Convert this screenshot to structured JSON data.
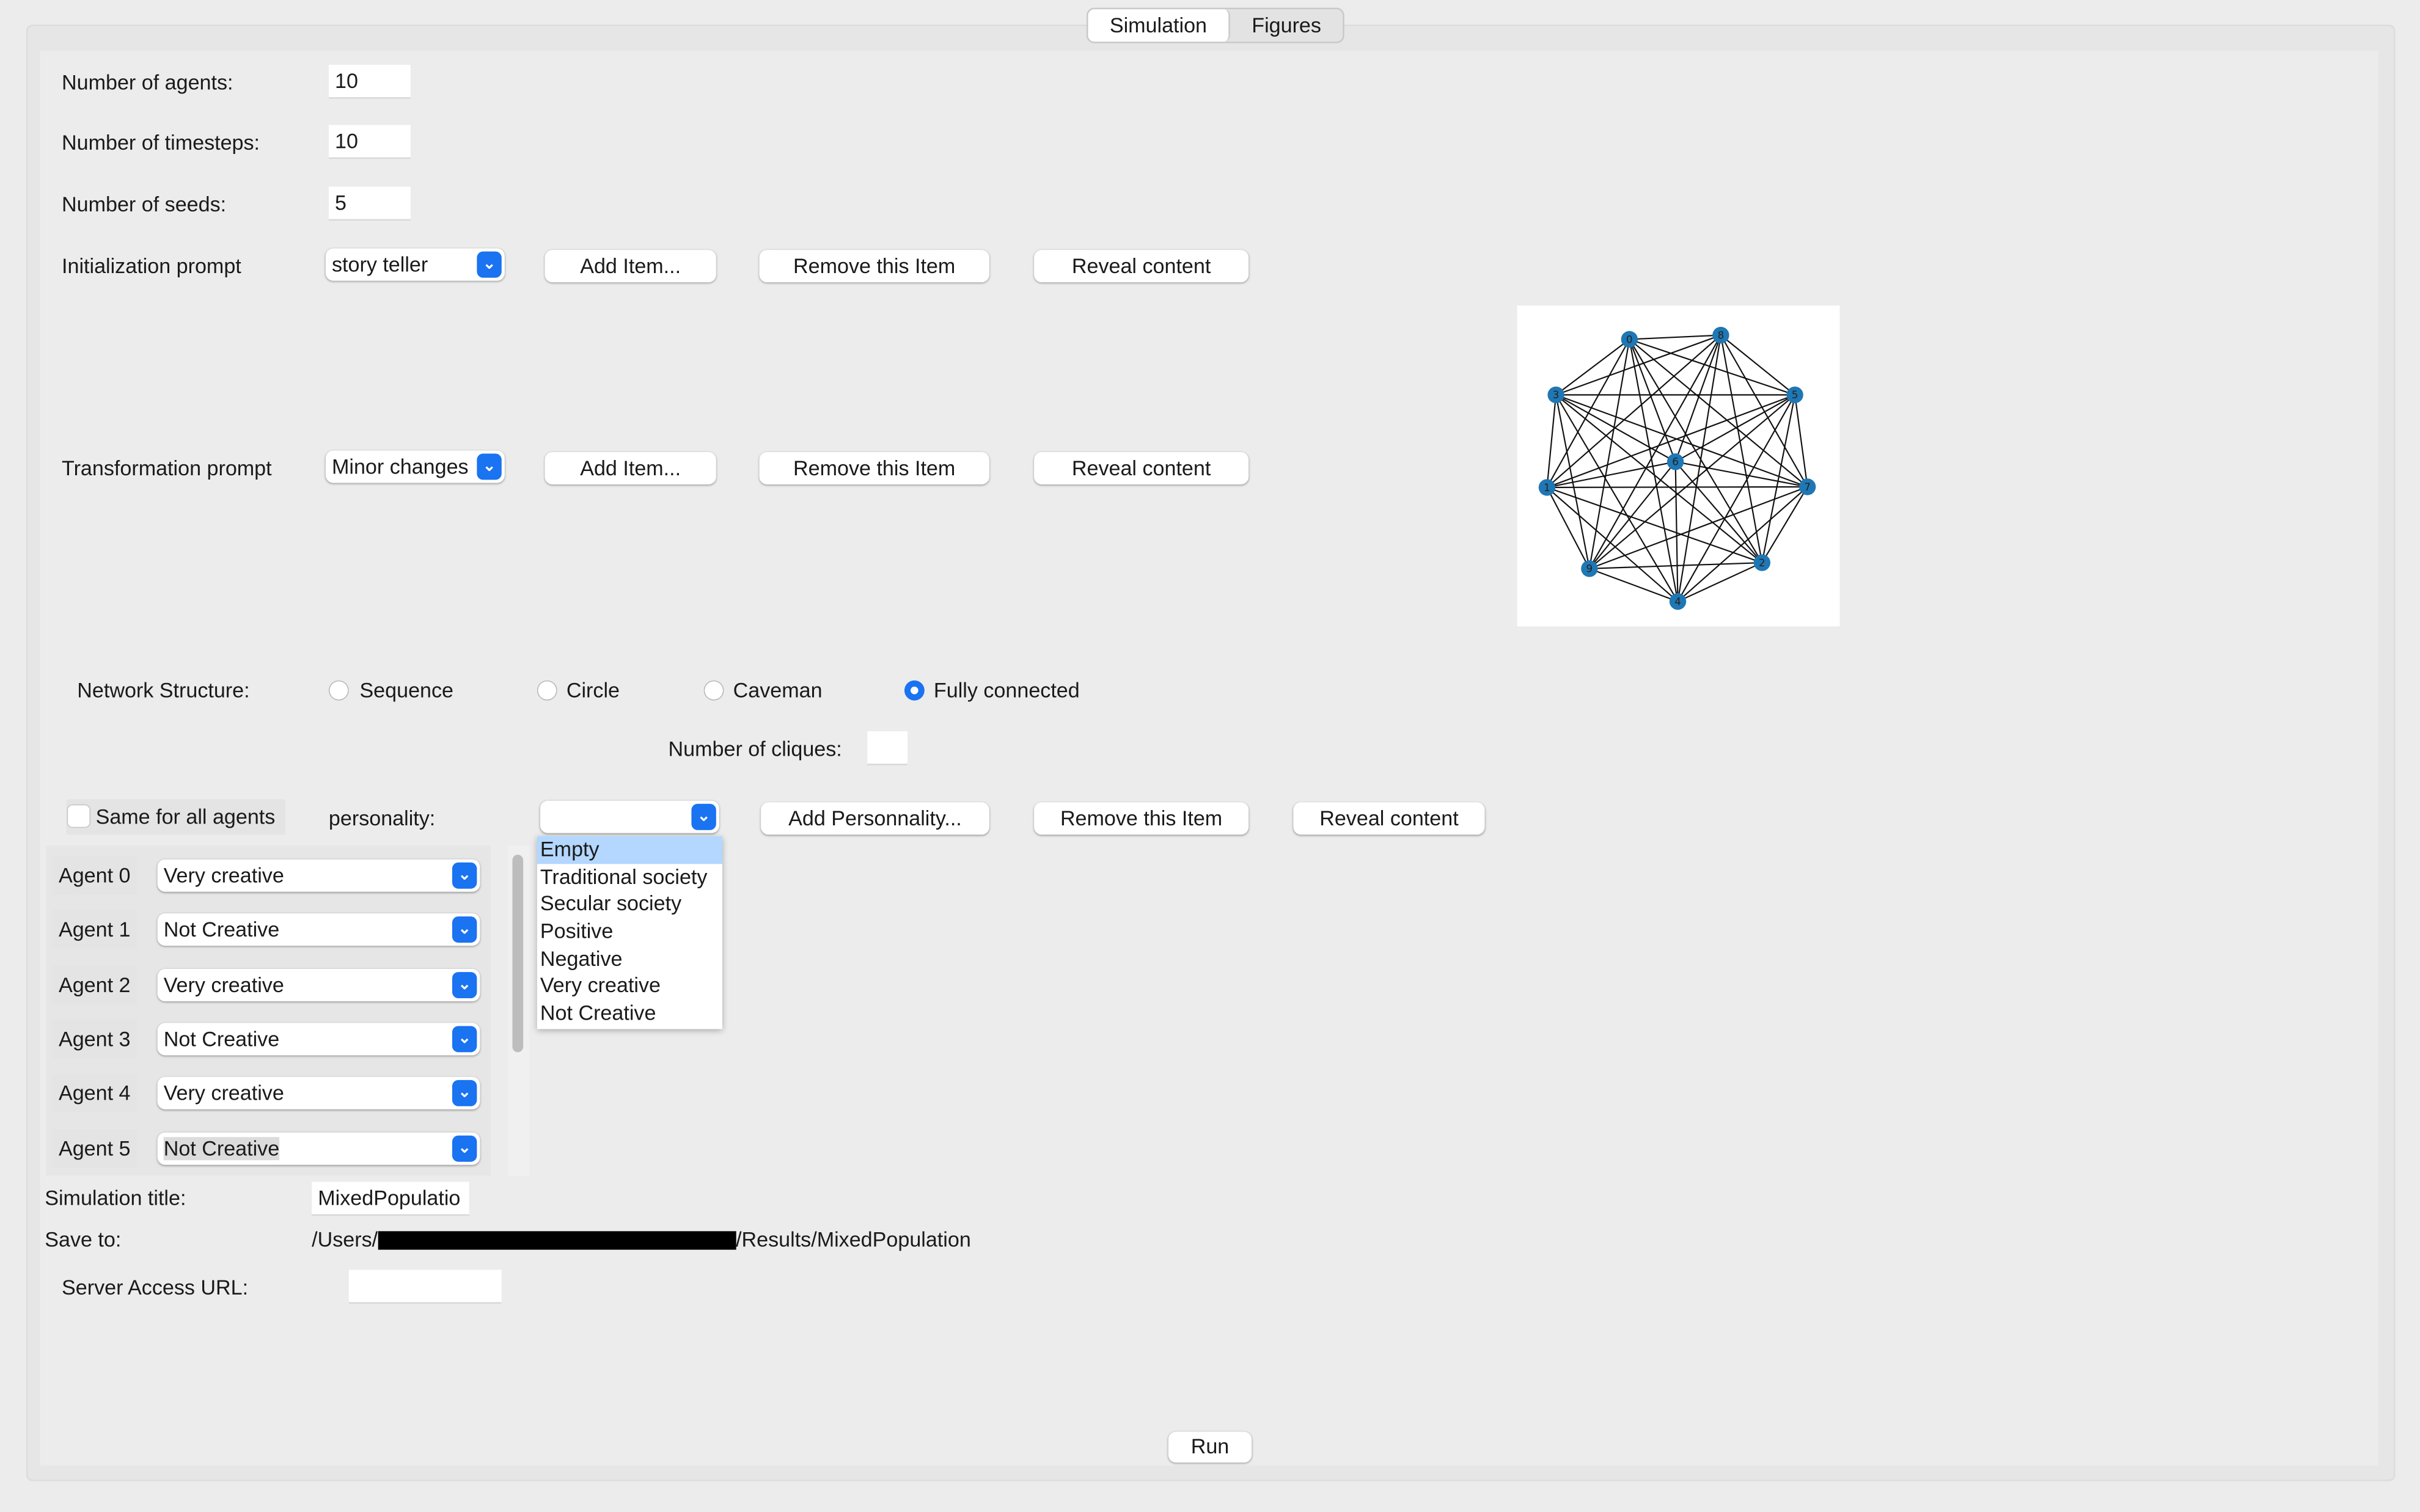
{
  "tabs": [
    {
      "label": "Simulation"
    },
    {
      "label": "Figures"
    }
  ],
  "fields": {
    "agents": {
      "label": "Number of agents:",
      "value": "10"
    },
    "timesteps": {
      "label": "Number of timesteps:",
      "value": "10"
    },
    "seeds": {
      "label": "Number of seeds:",
      "value": "5"
    }
  },
  "init_prompt": {
    "label": "Initialization prompt",
    "selected": "story teller",
    "add": "Add Item...",
    "remove": "Remove this Item",
    "reveal": "Reveal content"
  },
  "transform_prompt": {
    "label": "Transformation prompt",
    "selected": "Minor changes",
    "add": "Add Item...",
    "remove": "Remove this Item",
    "reveal": "Reveal content"
  },
  "network": {
    "label": "Network Structure:",
    "options": [
      {
        "label": "Sequence",
        "selected": false
      },
      {
        "label": "Circle",
        "selected": false
      },
      {
        "label": "Caveman",
        "selected": false
      },
      {
        "label": "Fully connected",
        "selected": true
      }
    ],
    "cliques_label": "Number of cliques:",
    "cliques_value": ""
  },
  "graph": {
    "node_labels": [
      "0",
      "1",
      "2",
      "3",
      "4",
      "5",
      "6",
      "7",
      "8",
      "9"
    ],
    "node_color": "#1f77b4"
  },
  "personality": {
    "same_label": "Same for all agents",
    "same_checked": false,
    "label": "personality:",
    "selected": "",
    "add": "Add Personnality...",
    "remove": "Remove this Item",
    "reveal": "Reveal content",
    "menu": [
      "Empty",
      "Traditional society",
      "Secular society",
      "Positive",
      "Negative",
      "Very creative",
      "Not Creative"
    ],
    "menu_highlight": "Empty"
  },
  "agents": [
    {
      "label": "Agent 0",
      "value": "Very creative"
    },
    {
      "label": "Agent 1",
      "value": "Not Creative"
    },
    {
      "label": "Agent 2",
      "value": "Very creative"
    },
    {
      "label": "Agent 3",
      "value": "Not Creative"
    },
    {
      "label": "Agent 4",
      "value": "Very creative"
    },
    {
      "label": "Agent 5",
      "value": "Not Creative"
    }
  ],
  "sim_title": {
    "label": "Simulation title:",
    "value": "MixedPopulatio"
  },
  "save_to": {
    "label": "Save to:",
    "prefix": "/Users/",
    "suffix": "/Results/MixedPopulation"
  },
  "server": {
    "label": "Server Access URL:",
    "value": ""
  },
  "run_label": "Run",
  "accent": "#1a73f0"
}
